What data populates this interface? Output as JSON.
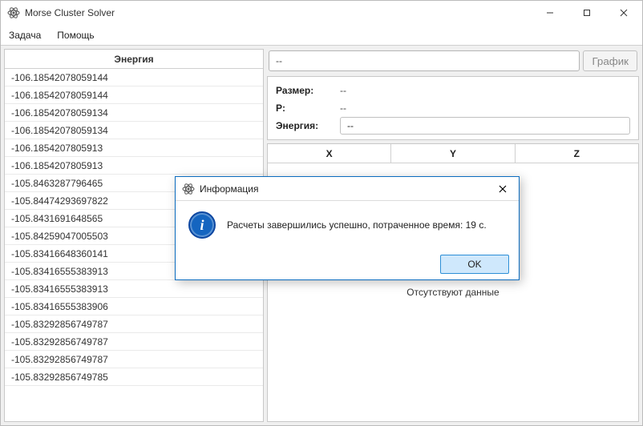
{
  "window": {
    "title": "Morse Cluster Solver"
  },
  "menu": {
    "task": "Задача",
    "help": "Помощь"
  },
  "left": {
    "header": "Энергия",
    "rows": [
      "-106.18542078059144",
      "-106.18542078059144",
      "-106.18542078059134",
      "-106.18542078059134",
      "-106.1854207805913",
      "-106.1854207805913",
      "-105.8463287796465",
      "-105.84474293697822",
      "-105.8431691648565",
      "-105.84259047005503",
      "-105.83416648360141",
      "-105.83416555383913",
      "-105.83416555383913",
      "-105.83416555383906",
      "-105.83292856749787",
      "-105.83292856749787",
      "-105.83292856749787",
      "-105.83292856749785"
    ]
  },
  "right": {
    "search_value": "--",
    "chart_btn": "График",
    "size_label": "Размер:",
    "size_value": "--",
    "p_label": "P:",
    "p_value": "--",
    "energy_label": "Энергия:",
    "energy_value": "--",
    "col_x": "X",
    "col_y": "Y",
    "col_z": "Z",
    "empty_msg": "Отсутствуют данные"
  },
  "dialog": {
    "title": "Информация",
    "message": "Расчеты завершились успешно, потраченное время: 19 с.",
    "ok": "OK",
    "info_glyph": "i"
  }
}
